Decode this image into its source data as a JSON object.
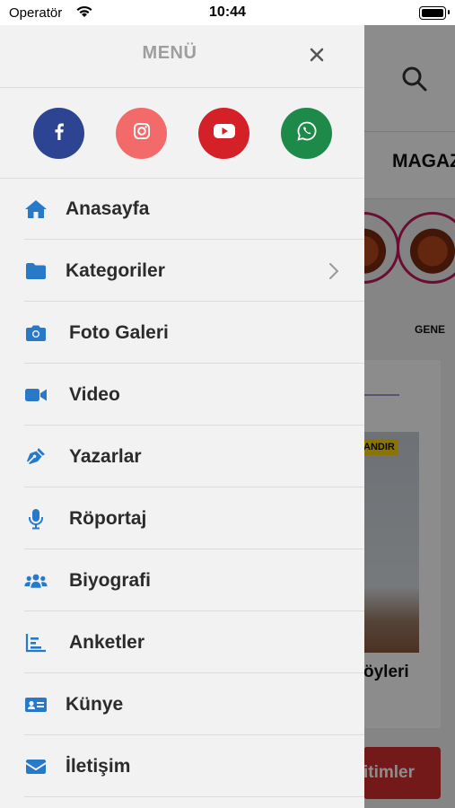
{
  "status_bar": {
    "carrier": "Operatör",
    "time": "10:44"
  },
  "drawer": {
    "title": "MENÜ",
    "social": [
      {
        "name": "facebook-icon",
        "color": "#2d4493"
      },
      {
        "name": "instagram-icon",
        "color": "#f26a6a"
      },
      {
        "name": "youtube-icon",
        "color": "#d42027"
      },
      {
        "name": "whatsapp-icon",
        "color": "#1e8a4a"
      }
    ],
    "items": [
      {
        "label": "Anasayfa",
        "icon": "home-icon"
      },
      {
        "label": "Kategoriler",
        "icon": "folder-icon",
        "has_chevron": true
      },
      {
        "label": "Foto Galeri",
        "icon": "camera-icon"
      },
      {
        "label": "Video",
        "icon": "video-icon"
      },
      {
        "label": "Yazarlar",
        "icon": "pen-icon"
      },
      {
        "label": "Röportaj",
        "icon": "microphone-icon"
      },
      {
        "label": "Biyografi",
        "icon": "users-icon"
      },
      {
        "label": "Anketler",
        "icon": "chart-icon"
      },
      {
        "label": "Künye",
        "icon": "id-card-icon"
      },
      {
        "label": "İletişim",
        "icon": "envelope-icon"
      }
    ],
    "icon_color": "#2979c9"
  },
  "background": {
    "category_tab": "MAGAZ",
    "story_label": "GENE",
    "badge": "ANDIR",
    "card_title": "öyleri",
    "button_label": "itimler"
  }
}
